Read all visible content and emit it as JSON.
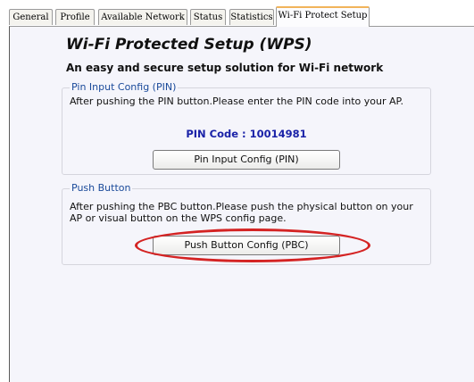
{
  "tabs": [
    {
      "label": "General",
      "active": false
    },
    {
      "label": "Profile",
      "active": false
    },
    {
      "label": "Available Network",
      "active": false
    },
    {
      "label": "Status",
      "active": false
    },
    {
      "label": "Statistics",
      "active": false
    },
    {
      "label": "Wi-Fi Protect Setup",
      "active": true
    }
  ],
  "wps": {
    "title": "Wi-Fi Protected Setup (WPS)",
    "subtitle": "An easy and secure setup solution for Wi-Fi network",
    "pin_group": {
      "legend": "Pin Input Config (PIN)",
      "instructions": "After pushing the PIN button.Please enter the PIN code into your AP.",
      "pin_code_label": "PIN Code :",
      "pin_code_value": "10014981",
      "button_label": "Pin Input Config (PIN)"
    },
    "pbc_group": {
      "legend": "Push Button",
      "instructions": "After pushing the PBC button.Please push the physical button on your AP or visual button on the WPS config page.",
      "button_label": "Push Button Config (PBC)"
    }
  },
  "colors": {
    "active_tab_accent": "#f1b45a",
    "highlight_oval": "#d42323",
    "pin_code_text": "#1a22a8",
    "legend_text": "#1a4a9a"
  }
}
